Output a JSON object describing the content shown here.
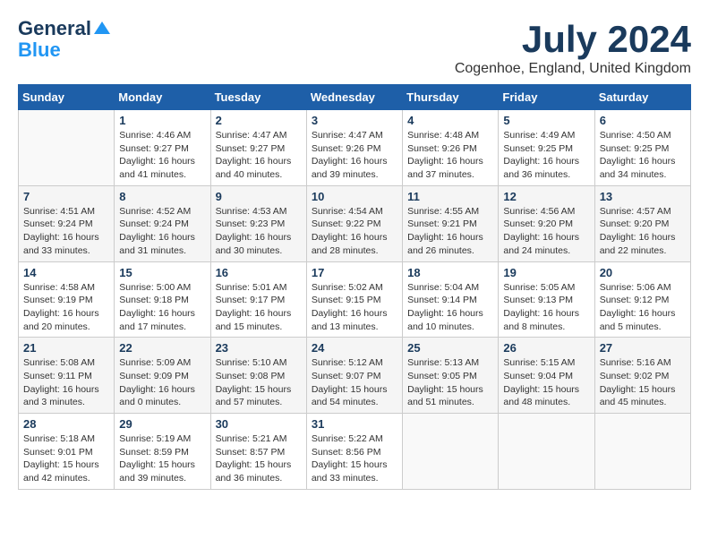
{
  "header": {
    "logo_general": "General",
    "logo_blue": "Blue",
    "month_title": "July 2024",
    "location": "Cogenhoe, England, United Kingdom"
  },
  "days_of_week": [
    "Sunday",
    "Monday",
    "Tuesday",
    "Wednesday",
    "Thursday",
    "Friday",
    "Saturday"
  ],
  "weeks": [
    [
      {
        "day": "",
        "info": ""
      },
      {
        "day": "1",
        "info": "Sunrise: 4:46 AM\nSunset: 9:27 PM\nDaylight: 16 hours\nand 41 minutes."
      },
      {
        "day": "2",
        "info": "Sunrise: 4:47 AM\nSunset: 9:27 PM\nDaylight: 16 hours\nand 40 minutes."
      },
      {
        "day": "3",
        "info": "Sunrise: 4:47 AM\nSunset: 9:26 PM\nDaylight: 16 hours\nand 39 minutes."
      },
      {
        "day": "4",
        "info": "Sunrise: 4:48 AM\nSunset: 9:26 PM\nDaylight: 16 hours\nand 37 minutes."
      },
      {
        "day": "5",
        "info": "Sunrise: 4:49 AM\nSunset: 9:25 PM\nDaylight: 16 hours\nand 36 minutes."
      },
      {
        "day": "6",
        "info": "Sunrise: 4:50 AM\nSunset: 9:25 PM\nDaylight: 16 hours\nand 34 minutes."
      }
    ],
    [
      {
        "day": "7",
        "info": "Sunrise: 4:51 AM\nSunset: 9:24 PM\nDaylight: 16 hours\nand 33 minutes."
      },
      {
        "day": "8",
        "info": "Sunrise: 4:52 AM\nSunset: 9:24 PM\nDaylight: 16 hours\nand 31 minutes."
      },
      {
        "day": "9",
        "info": "Sunrise: 4:53 AM\nSunset: 9:23 PM\nDaylight: 16 hours\nand 30 minutes."
      },
      {
        "day": "10",
        "info": "Sunrise: 4:54 AM\nSunset: 9:22 PM\nDaylight: 16 hours\nand 28 minutes."
      },
      {
        "day": "11",
        "info": "Sunrise: 4:55 AM\nSunset: 9:21 PM\nDaylight: 16 hours\nand 26 minutes."
      },
      {
        "day": "12",
        "info": "Sunrise: 4:56 AM\nSunset: 9:20 PM\nDaylight: 16 hours\nand 24 minutes."
      },
      {
        "day": "13",
        "info": "Sunrise: 4:57 AM\nSunset: 9:20 PM\nDaylight: 16 hours\nand 22 minutes."
      }
    ],
    [
      {
        "day": "14",
        "info": "Sunrise: 4:58 AM\nSunset: 9:19 PM\nDaylight: 16 hours\nand 20 minutes."
      },
      {
        "day": "15",
        "info": "Sunrise: 5:00 AM\nSunset: 9:18 PM\nDaylight: 16 hours\nand 17 minutes."
      },
      {
        "day": "16",
        "info": "Sunrise: 5:01 AM\nSunset: 9:17 PM\nDaylight: 16 hours\nand 15 minutes."
      },
      {
        "day": "17",
        "info": "Sunrise: 5:02 AM\nSunset: 9:15 PM\nDaylight: 16 hours\nand 13 minutes."
      },
      {
        "day": "18",
        "info": "Sunrise: 5:04 AM\nSunset: 9:14 PM\nDaylight: 16 hours\nand 10 minutes."
      },
      {
        "day": "19",
        "info": "Sunrise: 5:05 AM\nSunset: 9:13 PM\nDaylight: 16 hours\nand 8 minutes."
      },
      {
        "day": "20",
        "info": "Sunrise: 5:06 AM\nSunset: 9:12 PM\nDaylight: 16 hours\nand 5 minutes."
      }
    ],
    [
      {
        "day": "21",
        "info": "Sunrise: 5:08 AM\nSunset: 9:11 PM\nDaylight: 16 hours\nand 3 minutes."
      },
      {
        "day": "22",
        "info": "Sunrise: 5:09 AM\nSunset: 9:09 PM\nDaylight: 16 hours\nand 0 minutes."
      },
      {
        "day": "23",
        "info": "Sunrise: 5:10 AM\nSunset: 9:08 PM\nDaylight: 15 hours\nand 57 minutes."
      },
      {
        "day": "24",
        "info": "Sunrise: 5:12 AM\nSunset: 9:07 PM\nDaylight: 15 hours\nand 54 minutes."
      },
      {
        "day": "25",
        "info": "Sunrise: 5:13 AM\nSunset: 9:05 PM\nDaylight: 15 hours\nand 51 minutes."
      },
      {
        "day": "26",
        "info": "Sunrise: 5:15 AM\nSunset: 9:04 PM\nDaylight: 15 hours\nand 48 minutes."
      },
      {
        "day": "27",
        "info": "Sunrise: 5:16 AM\nSunset: 9:02 PM\nDaylight: 15 hours\nand 45 minutes."
      }
    ],
    [
      {
        "day": "28",
        "info": "Sunrise: 5:18 AM\nSunset: 9:01 PM\nDaylight: 15 hours\nand 42 minutes."
      },
      {
        "day": "29",
        "info": "Sunrise: 5:19 AM\nSunset: 8:59 PM\nDaylight: 15 hours\nand 39 minutes."
      },
      {
        "day": "30",
        "info": "Sunrise: 5:21 AM\nSunset: 8:57 PM\nDaylight: 15 hours\nand 36 minutes."
      },
      {
        "day": "31",
        "info": "Sunrise: 5:22 AM\nSunset: 8:56 PM\nDaylight: 15 hours\nand 33 minutes."
      },
      {
        "day": "",
        "info": ""
      },
      {
        "day": "",
        "info": ""
      },
      {
        "day": "",
        "info": ""
      }
    ]
  ]
}
